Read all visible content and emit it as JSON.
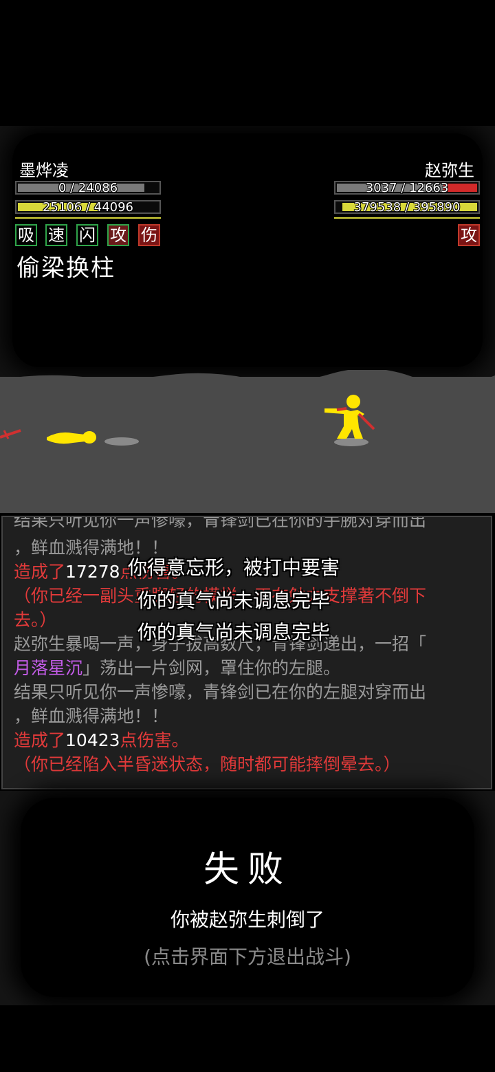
{
  "player": {
    "name": "墨烨凌",
    "hp_text": "0 / 24086",
    "hp_fraction": 0.0,
    "mp_text": "25106 / 44096",
    "mp_fraction": 0.57,
    "buffs": [
      "吸",
      "速",
      "闪",
      "攻",
      "伤"
    ],
    "skill": "偷梁换柱"
  },
  "enemy": {
    "name": "赵弥生",
    "hp_text": "3037 / 12663",
    "hp_fraction": 0.24,
    "mp_text": "379538 / 395890",
    "mp_fraction": 0.96,
    "buffs": [
      "攻"
    ]
  },
  "colors": {
    "hp_fill": "#8a8a8a",
    "enemy_hp_fill": "#d22a2a",
    "mp_fill": "#d8d83a",
    "figure": "#ffe600",
    "weapon": "#d03030"
  },
  "log": {
    "l0": "结果只听见你一声惨嚎，青锋剑已在你的手腕对穿而出",
    "l1": "，鲜血溅得满地！！",
    "l2a": "造成了",
    "l2b": "17278",
    "l2c": "点伤害。",
    "l3": "（你已经一副头重脚轻的模样，正在勉力支撑著不倒下",
    "l4": "去。）",
    "l5": "赵弥生暴喝一声，身子拔高数尺，青锋剑递出，一招「",
    "l6a": "月落星沉",
    "l6b": "」荡出一片剑网，罩住你的左腿。",
    "l7": "结果只听见你一声惨嚎，青锋剑已在你的左腿对穿而出",
    "l8": "，鲜血溅得满地！！",
    "l9a": "造成了",
    "l9b": "10423",
    "l9c": "点伤害。",
    "l10": "（你已经陷入半昏迷状态，随时都可能摔倒晕去。）"
  },
  "floating": {
    "f1": "你得意忘形，被打中要害",
    "f2": "你的真气尚未调息完毕",
    "f3": "你的真气尚未调息完毕"
  },
  "result": {
    "title": "失败",
    "message": "你被赵弥生刺倒了",
    "hint": "(点击界面下方退出战斗)"
  }
}
